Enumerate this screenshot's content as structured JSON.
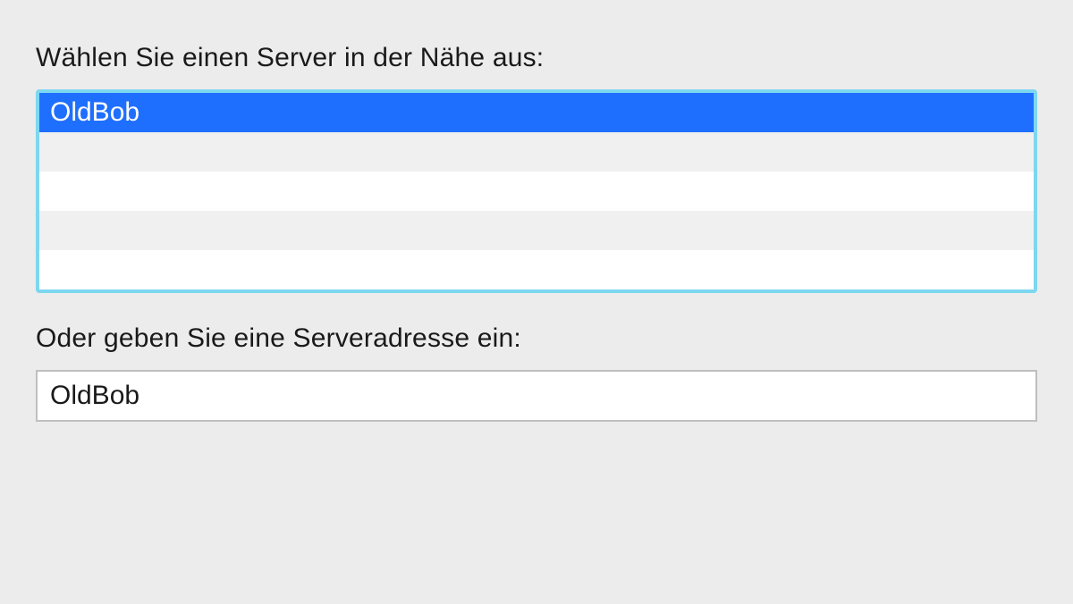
{
  "labels": {
    "choose_server": "Wählen Sie einen Server in der Nähe aus:",
    "enter_address": "Oder geben Sie eine Serveradresse ein:"
  },
  "server_list": {
    "rows": [
      {
        "name": "OldBob",
        "selected": true
      }
    ]
  },
  "address_input": {
    "value": "OldBob"
  }
}
